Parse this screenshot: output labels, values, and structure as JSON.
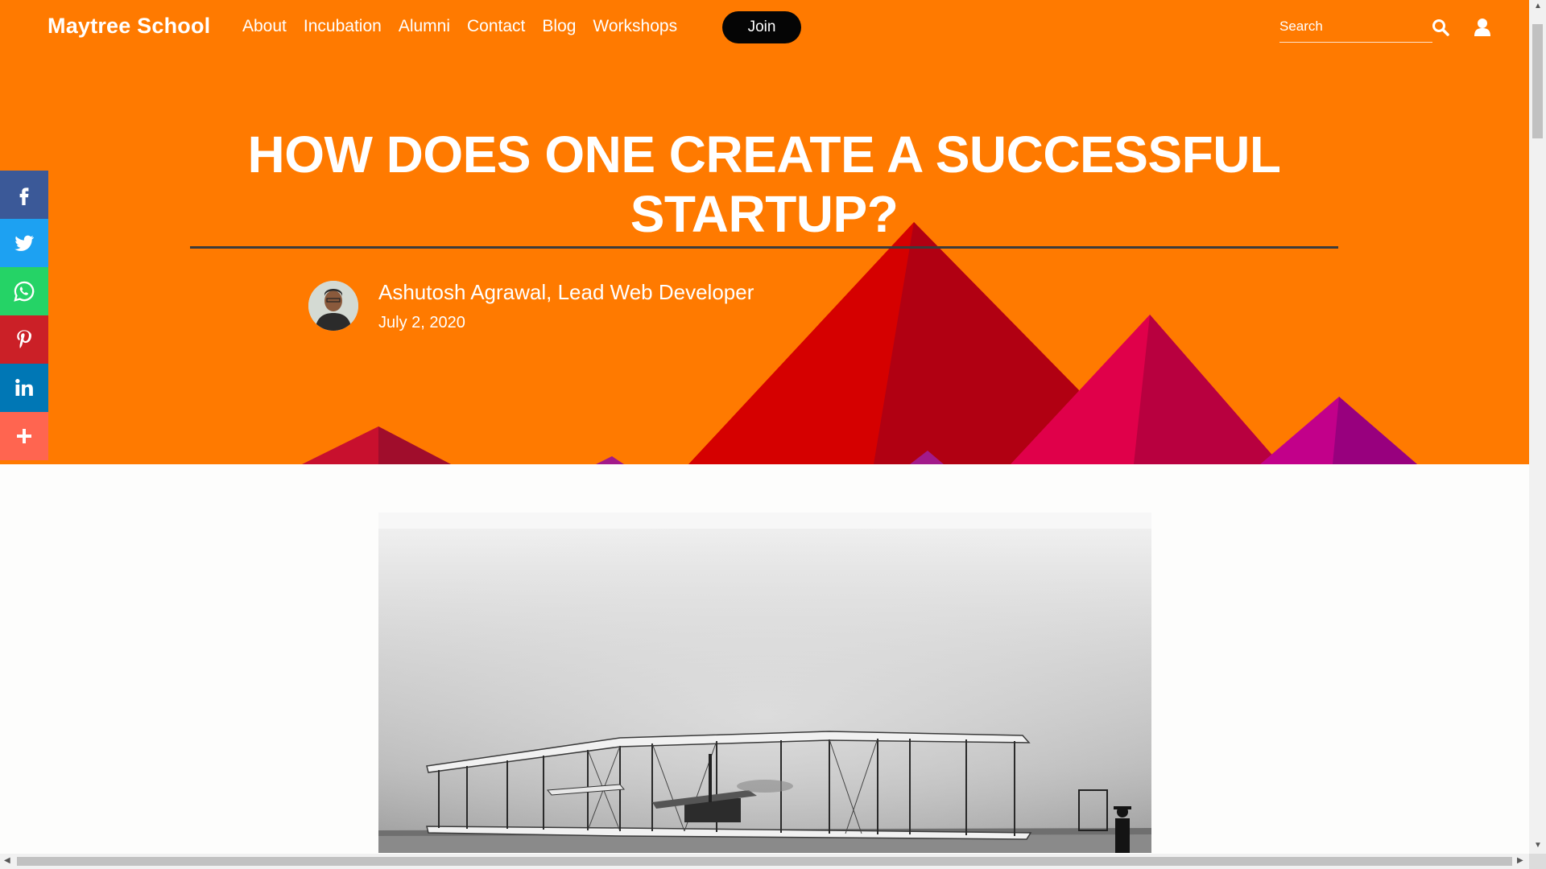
{
  "nav": {
    "brand": "Maytree School",
    "links": [
      "About",
      "Incubation",
      "Alumni",
      "Contact",
      "Blog",
      "Workshops"
    ],
    "join_label": "Join",
    "search_placeholder": "Search"
  },
  "post": {
    "title": "HOW DOES ONE CREATE A SUCCESSFUL STARTUP?",
    "author": "Ashutosh Agrawal, Lead Web Developer",
    "date": "July 2, 2020"
  },
  "share": [
    {
      "name": "facebook",
      "icon": "facebook-icon",
      "color": "#3b5998"
    },
    {
      "name": "twitter",
      "icon": "twitter-icon",
      "color": "#1da1f2"
    },
    {
      "name": "whatsapp",
      "icon": "whatsapp-icon",
      "color": "#25d366"
    },
    {
      "name": "pinterest",
      "icon": "pinterest-icon",
      "color": "#cb2027"
    },
    {
      "name": "linkedin",
      "icon": "linkedin-icon",
      "color": "#0077b5"
    },
    {
      "name": "more",
      "icon": "plus-icon",
      "color": "#ff6550"
    }
  ],
  "colors": {
    "hero_background": "#ff7a00",
    "join_button": "#050505"
  }
}
